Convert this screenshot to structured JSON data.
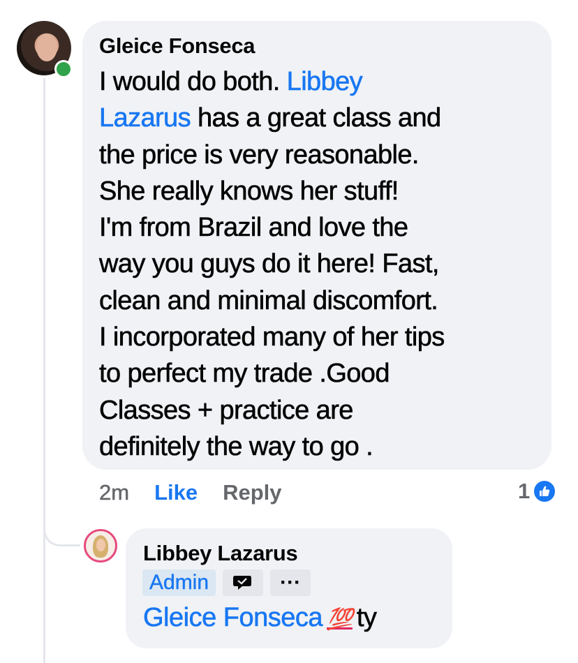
{
  "comment": {
    "author": "Gleice Fonseca",
    "mention": "Libbey Lazarus",
    "text_lines": [
      {
        "mention": "",
        "text": "I would do both. "
      },
      {
        "mention": "Libbey",
        "text": ""
      },
      {
        "mention": "Lazarus",
        "text": " has a great class and"
      },
      {
        "mention": "",
        "text": "the price is very reasonable."
      },
      {
        "mention": "",
        "text": "She really knows her stuff!"
      },
      {
        "mention": "",
        "text": "I'm from Brazil and love the"
      },
      {
        "mention": "",
        "text": "way you guys do it here! Fast,"
      },
      {
        "mention": "",
        "text": "clean and minimal discomfort."
      },
      {
        "mention": "",
        "text": "I incorporated many of her tips"
      },
      {
        "mention": "",
        "text": "to perfect my trade .Good"
      },
      {
        "mention": "",
        "text": "Classes + practice are"
      },
      {
        "mention": "",
        "text": "definitely the way to go ."
      }
    ],
    "time": "2m",
    "like_label": "Like",
    "reply_label": "Reply",
    "reaction_count": "1",
    "reaction_icon": "like-thumb-icon",
    "online": true
  },
  "reply": {
    "author": "Libbey Lazarus",
    "badge": "Admin",
    "badge_icons": [
      "chat-bubble-icon",
      "more-dots-icon"
    ],
    "more_label": "···",
    "mention": "Gleice Fonseca",
    "emoji": "💯",
    "text": "ty"
  },
  "colors": {
    "link": "#1877f2",
    "bubble": "#f0f2f5",
    "muted": "#65676b",
    "online": "#31a24c",
    "avatar_ring": "#e64b7e"
  }
}
